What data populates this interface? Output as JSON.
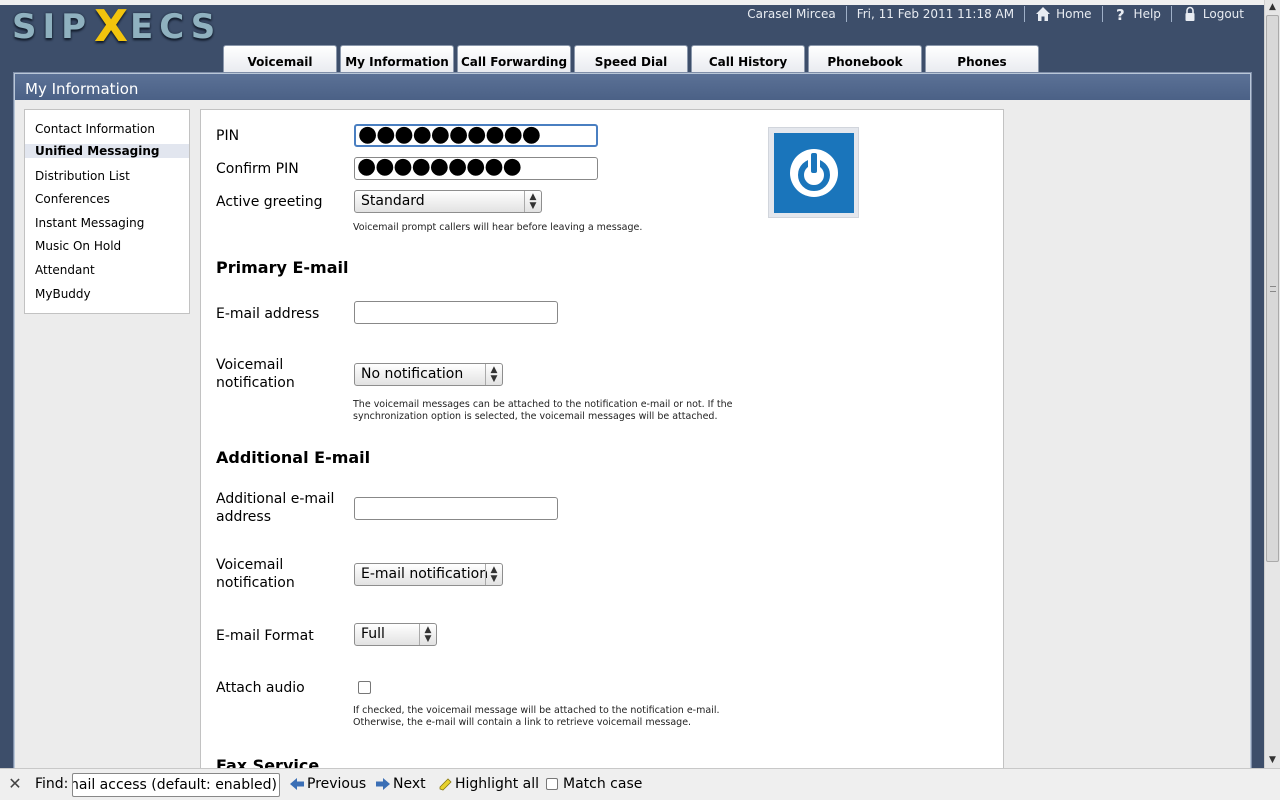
{
  "app": {
    "logo_left": "SIP",
    "logo_x": "X",
    "logo_right": "ECS"
  },
  "topnav": {
    "user": "Carasel Mircea",
    "datetime": "Fri, 11 Feb 2011 11:18 AM",
    "home": "Home",
    "help": "Help",
    "logout": "Logout"
  },
  "tabs": [
    "Voicemail",
    "My Information",
    "Call Forwarding",
    "Speed Dial",
    "Call History",
    "Phonebook",
    "Phones"
  ],
  "panel": {
    "title": "My Information"
  },
  "sidebar": {
    "items": [
      "Contact Information",
      "Unified Messaging",
      "Distribution List",
      "Conferences",
      "Instant Messaging",
      "Music On Hold",
      "Attendant",
      "MyBuddy"
    ],
    "active": "Unified Messaging"
  },
  "form": {
    "pin_label": "PIN",
    "pin_value": "●●●●●●●●●●",
    "confirm_pin_label": "Confirm PIN",
    "confirm_pin_value": "●●●●●●●●●",
    "active_greeting_label": "Active greeting",
    "active_greeting_value": "Standard",
    "active_greeting_help": "Voicemail prompt callers will hear before leaving a message.",
    "primary_email_heading": "Primary E-mail",
    "email_address_label": "E-mail address",
    "email_address_value": "",
    "vm_notification_label": "Voicemail notification",
    "vm_notification_value": "No notification",
    "vm_notification_help": "The voicemail messages can be attached to the notification e-mail or not. If the synchronization option is selected, the voicemail messages will be attached.",
    "additional_email_heading": "Additional E-mail",
    "additional_email_label": "Additional e-mail address",
    "additional_email_value": "",
    "additional_vm_notification_label": "Voicemail notification",
    "additional_vm_notification_value": "E-mail notification",
    "email_format_label": "E-mail Format",
    "email_format_value": "Full",
    "attach_audio_label": "Attach audio",
    "attach_audio_checked": false,
    "attach_audio_help": "If checked, the voicemail message will be attached to the notification e-mail. Otherwise, the e-mail will contain a link to retrieve voicemail message.",
    "fax_heading": "Fax Service"
  },
  "findbar": {
    "label": "Find:",
    "query": "mail access (default: enabled)",
    "previous": "Previous",
    "next": "Next",
    "highlight": "Highlight all",
    "match_case": "Match case"
  },
  "colors": {
    "background": "#3d4e6a",
    "panel_header": "#5b7196",
    "accent_blue": "#1a75bb",
    "logo_x": "#f2c40d"
  }
}
